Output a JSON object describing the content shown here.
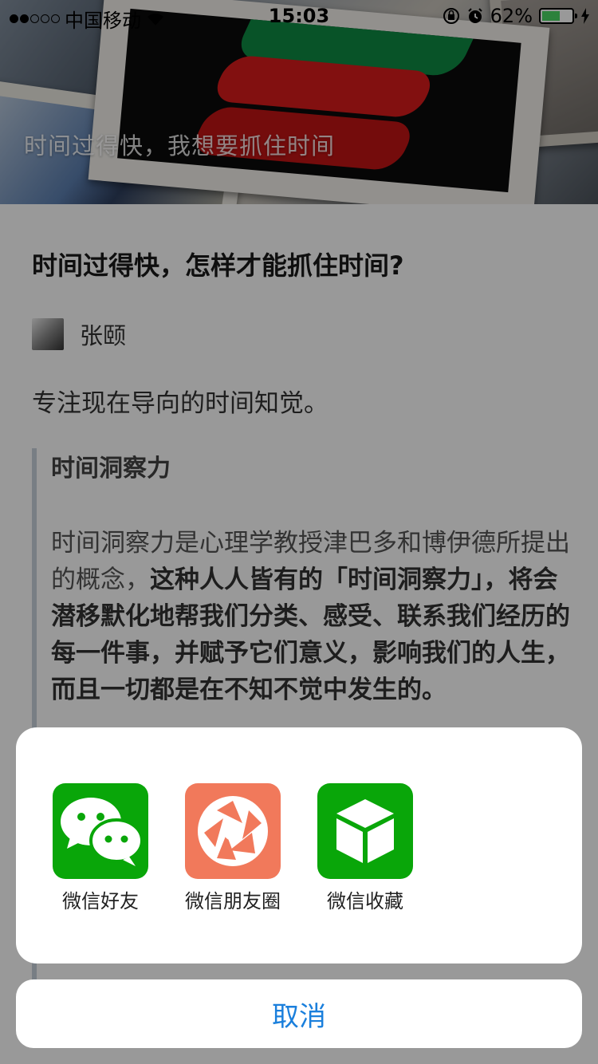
{
  "status_bar": {
    "signal_dots_filled": 2,
    "signal_dots_total": 5,
    "carrier": "中国移动",
    "time": "15:03",
    "battery_percent": "62%",
    "battery_level": 0.62,
    "battery_color": "#4cd964"
  },
  "hero": {
    "caption": "时间过得快，我想要抓住时间"
  },
  "article": {
    "title": "时间过得快，怎样才能抓住时间?",
    "author": "张颐",
    "lead": "专注现在导向的时间知觉。",
    "quote_heading": "时间洞察力",
    "quote_text_plain": "时间洞察力是心理学教授津巴多和博伊德所提出的概念，",
    "quote_text_bold": "这种人人皆有的「时间洞察力」，将会潜移默化地帮我们分类、感受、联系我们经历的每一件事，并赋予它们意义，影响我们的人生，而且一切都是在不知不觉中发生的。"
  },
  "share_sheet": {
    "items": [
      {
        "label": "微信好友",
        "icon": "wechat-chat-icon",
        "color": "#09a609"
      },
      {
        "label": "微信朋友圈",
        "icon": "wechat-moments-icon",
        "color": "#f1795b"
      },
      {
        "label": "微信收藏",
        "icon": "wechat-favorites-icon",
        "color": "#09a609"
      }
    ],
    "cancel_label": "取消",
    "cancel_color": "#1a7fdc"
  }
}
